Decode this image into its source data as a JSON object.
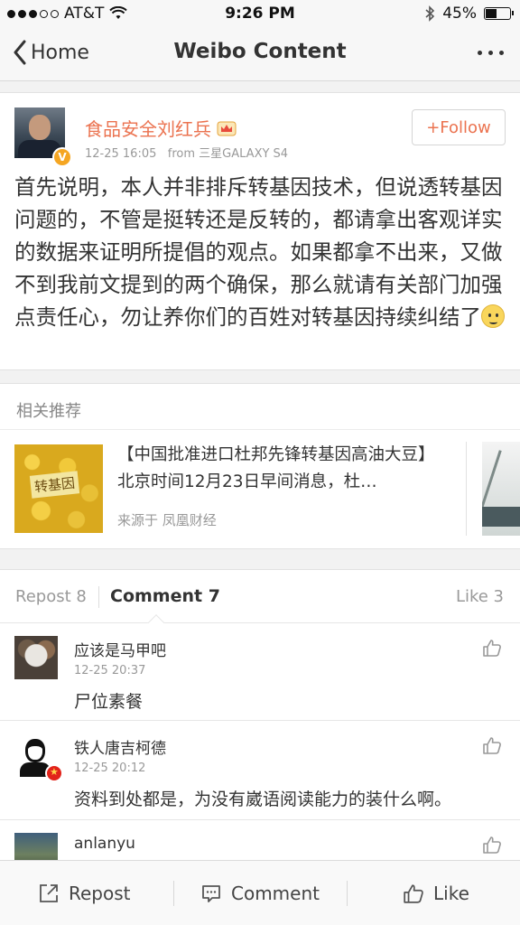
{
  "status_bar": {
    "carrier": "AT&T",
    "time": "9:26 PM",
    "battery": "45%",
    "battery_level": 0.45
  },
  "nav": {
    "back_label": "Home",
    "title": "Weibo Content"
  },
  "post": {
    "author": "食品安全刘红兵",
    "verified_badge": "V",
    "time": "12-25 16:05",
    "source": "from 三星GALAXY S4",
    "follow_label": "+Follow",
    "text": "首先说明，本人并非排斥转基因技术，但说透转基因问题的，不管是挺转还是反转的，都请拿出客观详实的数据来证明所提倡的观点。如果都拿不出来，又做不到我前文提到的两个确保，那么就请有关部门加强点责任心，勿让养你们的百姓对转基因持续纠结了"
  },
  "related": {
    "title": "相关推荐",
    "items": [
      {
        "thumb_text": "转基因",
        "title": "【中国批准进口杜邦先锋转基因高油大豆】北京时间12月23日早间消息，杜…",
        "source": "来源于 凤凰财经"
      }
    ]
  },
  "tabs": {
    "repost": "Repost 8",
    "comment": "Comment 7",
    "like": "Like 3"
  },
  "comments": [
    {
      "name": "应该是马甲吧",
      "time": "12-25 20:37",
      "text": "尸位素餐"
    },
    {
      "name": "铁人唐吉柯德",
      "time": "12-25 20:12",
      "text": "资料到处都是，为没有崴语阅读能力的装什么啊。"
    },
    {
      "name": "anlanyu",
      "time": "",
      "text": ""
    }
  ],
  "toolbar": {
    "repost": "Repost",
    "comment": "Comment",
    "like": "Like"
  },
  "colors": {
    "accent": "#eb7350",
    "text": "#333333",
    "muted": "#999999"
  }
}
